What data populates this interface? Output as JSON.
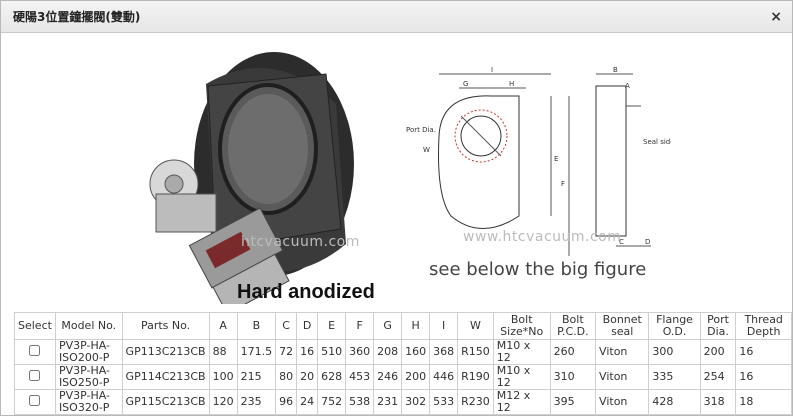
{
  "dialog": {
    "title": "硬陽3位置鐘擺閥(雙動)",
    "close_label": "×"
  },
  "figure": {
    "watermark_left": "htcvacuum.com",
    "watermark_right": "www.htcvacuum.com",
    "caption": "see below the big figure",
    "overlay_text": "Hard anodized",
    "drawing_labels": {
      "I": "I",
      "G": "G",
      "H": "H",
      "B": "B",
      "A": "A",
      "port_dia": "Port Dia.",
      "w": "W",
      "e": "E",
      "f": "F",
      "seal_side": "Seal side",
      "c": "C",
      "d": "D"
    }
  },
  "table": {
    "headers": [
      "Select",
      "Model No.",
      "Parts No.",
      "A",
      "B",
      "C",
      "D",
      "E",
      "F",
      "G",
      "H",
      "I",
      "W",
      "Bolt Size*No",
      "Bolt P.C.D.",
      "Bonnet seal",
      "Flange O.D.",
      "Port Dia.",
      "Thread Depth"
    ],
    "rows": [
      {
        "model": "PV3P-HA-ISO200-P",
        "part": "GP113C213CB",
        "A": "88",
        "B": "171.5",
        "C": "72",
        "D": "16",
        "E": "510",
        "F": "360",
        "G": "208",
        "H": "160",
        "I": "368",
        "W": "R150",
        "bolt_size": "M10 x 12",
        "pcd": "260",
        "seal": "Viton",
        "flange_od": "300",
        "port_dia": "200",
        "thread_depth": "16"
      },
      {
        "model": "PV3P-HA-ISO250-P",
        "part": "GP114C213CB",
        "A": "100",
        "B": "215",
        "C": "80",
        "D": "20",
        "E": "628",
        "F": "453",
        "G": "246",
        "H": "200",
        "I": "446",
        "W": "R190",
        "bolt_size": "M10 x 12",
        "pcd": "310",
        "seal": "Viton",
        "flange_od": "335",
        "port_dia": "254",
        "thread_depth": "16"
      },
      {
        "model": "PV3P-HA-ISO320-P",
        "part": "GP115C213CB",
        "A": "120",
        "B": "235",
        "C": "96",
        "D": "24",
        "E": "752",
        "F": "538",
        "G": "231",
        "H": "302",
        "I": "533",
        "W": "R230",
        "bolt_size": "M12 x 12",
        "pcd": "395",
        "seal": "Viton",
        "flange_od": "428",
        "port_dia": "318",
        "thread_depth": "18"
      }
    ]
  }
}
